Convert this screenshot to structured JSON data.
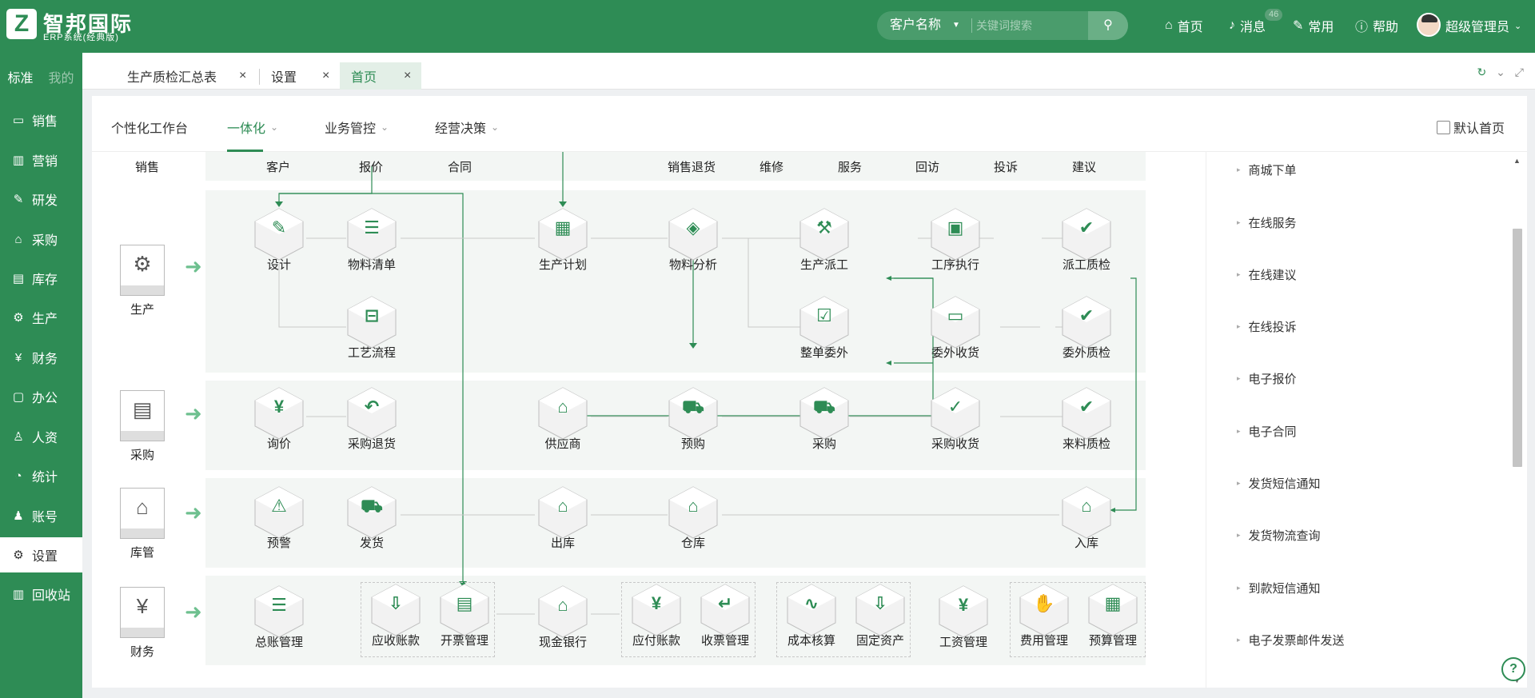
{
  "brand": {
    "logo_letter": "Z",
    "title": "智邦国际",
    "subtitle": "ERP系统(经典版)",
    "accent": "#2e8c55"
  },
  "header": {
    "search": {
      "select_value": "客户名称",
      "placeholder": "关键词搜索"
    },
    "nav": [
      {
        "label": "首页",
        "icon": "home-icon"
      },
      {
        "label": "消息",
        "icon": "bell-icon",
        "badge": "46"
      },
      {
        "label": "常用",
        "icon": "wrench-icon"
      },
      {
        "label": "帮助",
        "icon": "help-icon"
      }
    ],
    "user": "超级管理员"
  },
  "sidebar": {
    "tabs": [
      "标准",
      "我的"
    ],
    "items": [
      {
        "label": "销售",
        "icon": "chat-icon"
      },
      {
        "label": "营销",
        "icon": "chart-icon"
      },
      {
        "label": "研发",
        "icon": "pen-icon"
      },
      {
        "label": "采购",
        "icon": "basket-icon"
      },
      {
        "label": "库存",
        "icon": "stock-icon"
      },
      {
        "label": "生产",
        "icon": "factory-icon"
      },
      {
        "label": "财务",
        "icon": "yen-icon"
      },
      {
        "label": "办公",
        "icon": "briefcase-icon"
      },
      {
        "label": "人资",
        "icon": "person-icon"
      },
      {
        "label": "统计",
        "icon": "pie-icon"
      },
      {
        "label": "账号",
        "icon": "user-icon"
      },
      {
        "label": "设置",
        "icon": "gear-icon",
        "active": true
      },
      {
        "label": "回收站",
        "icon": "trash-icon"
      }
    ]
  },
  "tabs": [
    {
      "label": "生产质检汇总表"
    },
    {
      "label": "设置"
    },
    {
      "label": "首页",
      "active": true
    }
  ],
  "subnav": {
    "items": [
      {
        "label": "个性化工作台"
      },
      {
        "label": "一体化",
        "active": true
      },
      {
        "label": "业务管控"
      },
      {
        "label": "经营决策"
      }
    ],
    "default_home": "默认首页"
  },
  "diagram": {
    "sales_row": {
      "category": "销售",
      "items": [
        "客户",
        "报价",
        "合同",
        "销售退货",
        "维修",
        "服务",
        "回访",
        "投诉",
        "建议"
      ]
    },
    "production": {
      "category": "生产",
      "nodes": [
        "设计",
        "物料清单",
        "生产计划",
        "物料分析",
        "生产派工",
        "工序执行",
        "派工质检",
        "工艺流程",
        "整单委外",
        "委外收货",
        "委外质检"
      ]
    },
    "purchase": {
      "category": "采购",
      "nodes": [
        "询价",
        "采购退货",
        "供应商",
        "预购",
        "采购",
        "采购收货",
        "来料质检"
      ]
    },
    "warehouse": {
      "category": "库管",
      "nodes": [
        "预警",
        "发货",
        "出库",
        "仓库",
        "入库"
      ]
    },
    "finance": {
      "category": "财务",
      "nodes": [
        "总账管理",
        "应收账款",
        "开票管理",
        "现金银行",
        "应付账款",
        "收票管理",
        "成本核算",
        "固定资产",
        "工资管理",
        "费用管理",
        "预算管理"
      ]
    }
  },
  "right_list": [
    "商城下单",
    "在线服务",
    "在线建议",
    "在线投诉",
    "电子报价",
    "电子合同",
    "发货短信通知",
    "发货物流查询",
    "到款短信通知",
    "电子发票邮件发送"
  ]
}
